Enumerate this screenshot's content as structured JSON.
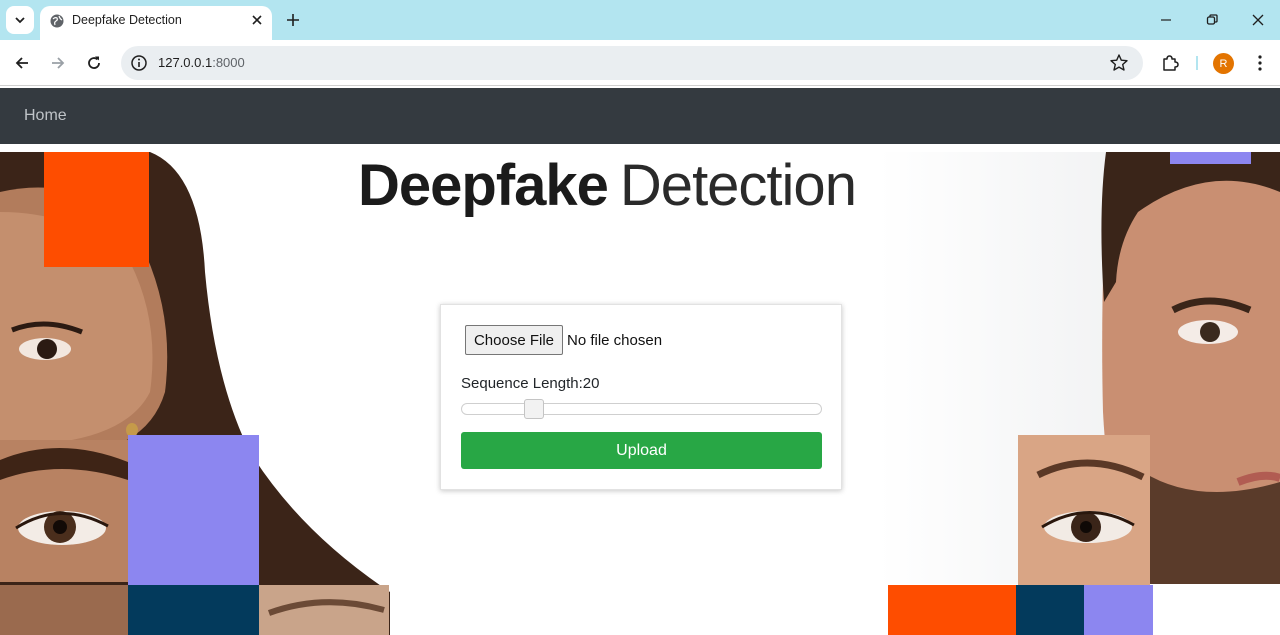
{
  "browser": {
    "tab": {
      "title": "Deepfake Detection",
      "favicon": "globe-icon"
    },
    "address": {
      "host": "127.0.0.1",
      "port": ":8000"
    },
    "profile_initial": "R"
  },
  "navbar": {
    "home_label": "Home"
  },
  "hero": {
    "title_bold": "Deepfake",
    "title_light": "Detection"
  },
  "form": {
    "file_button_label": "Choose File",
    "file_status": "No file chosen",
    "sequence_label": "Sequence Length:",
    "sequence_value": "20",
    "slider_fraction": 0.2,
    "upload_label": "Upload"
  },
  "colors": {
    "tabbar": "#b3e5f0",
    "navbar": "#343a40",
    "upload_button": "#28a745",
    "orange_block": "#fe4d00",
    "purple_block": "#8c86f0",
    "navy_block": "#033a5c"
  }
}
